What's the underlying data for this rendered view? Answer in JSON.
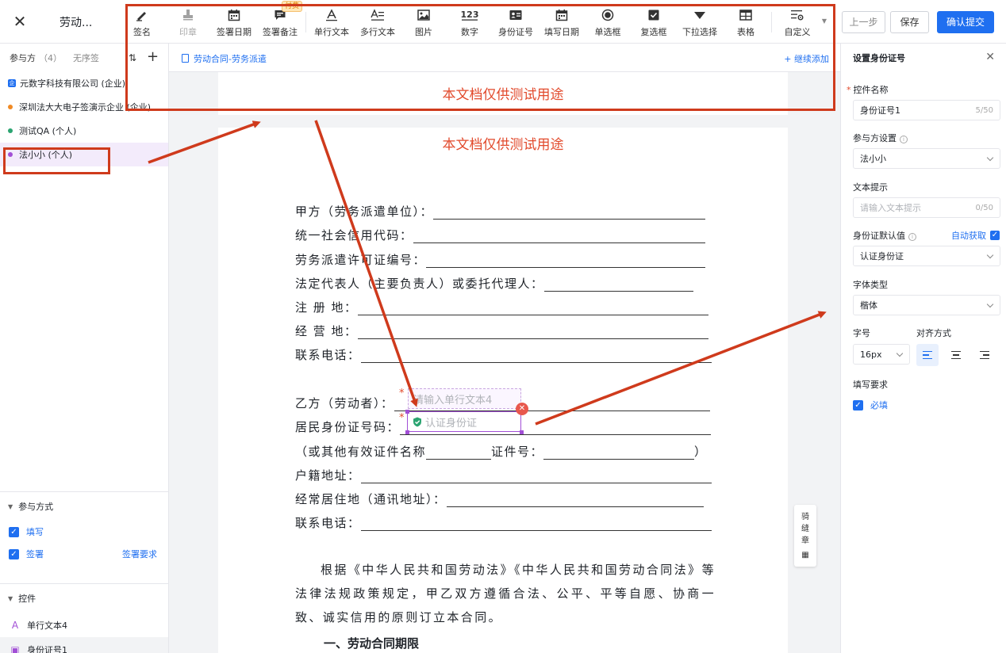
{
  "header": {
    "doc_title": "劳动...",
    "prev_label": "上一步",
    "save_label": "保存",
    "submit_label": "确认提交",
    "paid_tag": "付费"
  },
  "toolbar": [
    {
      "key": "signature",
      "label": "签名",
      "icon": "pen-icon",
      "disabled": false
    },
    {
      "key": "seal",
      "label": "印章",
      "icon": "stamp-icon",
      "disabled": true
    },
    {
      "key": "sign_date",
      "label": "签署日期",
      "icon": "calendar-icon",
      "disabled": false
    },
    {
      "key": "sign_note",
      "label": "签署备注",
      "icon": "comment-icon",
      "disabled": false
    },
    {
      "key": "single_text",
      "label": "单行文本",
      "icon": "text-a-icon",
      "disabled": false
    },
    {
      "key": "multi_text",
      "label": "多行文本",
      "icon": "multiline-text-icon",
      "disabled": false
    },
    {
      "key": "image",
      "label": "图片",
      "icon": "image-icon",
      "disabled": false
    },
    {
      "key": "number",
      "label": "数字",
      "icon": "number-123-icon",
      "disabled": false
    },
    {
      "key": "id_card",
      "label": "身份证号",
      "icon": "id-card-icon",
      "disabled": false
    },
    {
      "key": "fill_date",
      "label": "填写日期",
      "icon": "calendar-icon",
      "disabled": false
    },
    {
      "key": "radio",
      "label": "单选框",
      "icon": "radio-icon",
      "disabled": false
    },
    {
      "key": "checkbox",
      "label": "复选框",
      "icon": "checkbox-icon",
      "disabled": false
    },
    {
      "key": "dropdown",
      "label": "下拉选择",
      "icon": "triangle-down-icon",
      "disabled": false
    },
    {
      "key": "table",
      "label": "表格",
      "icon": "table-icon",
      "disabled": false
    },
    {
      "key": "custom",
      "label": "自定义",
      "icon": "custom-settings-icon",
      "disabled": false
    }
  ],
  "left": {
    "participants_title": "参与方",
    "participants_count": "（4）",
    "no_order": "无序签",
    "parties": [
      {
        "name": "元数字科技有限公司 (企业)",
        "type": "corp",
        "color": "#1f6ff0"
      },
      {
        "name": "深圳法大大电子签演示企业 (企业)",
        "type": "dot",
        "color": "#f08a24"
      },
      {
        "name": "测试QA (个人)",
        "type": "dot",
        "color": "#2ba471"
      },
      {
        "name": "法小小 (个人)",
        "type": "dot",
        "color": "#a24fd6"
      }
    ],
    "method_title": "参与方式",
    "method_fill": "填写",
    "method_sign": "签署",
    "sign_req_link": "签署要求",
    "controls_title": "控件",
    "controls": [
      {
        "label": "单行文本4",
        "icon": "text-a-icon"
      },
      {
        "label": "身份证号1",
        "icon": "id-card-icon"
      }
    ]
  },
  "center": {
    "breadcrumb": "劳动合同-劳务派遣",
    "continue_add": "继续添加",
    "watermark": "本文档仅供测试用途",
    "party_a": [
      "甲方（劳务派遣单位）：",
      "统一社会信用代码：",
      "劳务派遣许可证编号：",
      "法定代表人（主要负责人）或委托代理人：",
      "注  册  地：",
      "经  营  地：",
      "联系电话："
    ],
    "party_b_label": "乙方（劳动者）：",
    "id_label": "居民身份证号码：",
    "other_cert": "（或其他有效证件名称",
    "cert_no": "证件号：",
    "close_paren": "）",
    "party_b_rest": [
      "户籍地址：",
      "经常居住地（通讯地址）：",
      "联系电话："
    ],
    "field_text_placeholder": "请输入单行文本4",
    "field_id_placeholder": "认证身份证",
    "paragraph": "根据《中华人民共和国劳动法》《中华人民共和国劳动合同法》等法律法规政策规定，甲乙双方遵循合法、公平、平等自愿、协商一致、诚实信用的原则订立本合同。",
    "section_heading": "一、劳动合同期限",
    "seam_label": "骑缝章"
  },
  "right": {
    "title": "设置身份证号",
    "name_label": "控件名称",
    "name_value": "身份证号1",
    "name_count": "5/50",
    "party_label": "参与方设置",
    "party_value": "法小小",
    "hint_label": "文本提示",
    "hint_placeholder": "请输入文本提示",
    "hint_count": "0/50",
    "default_label": "身份证默认值",
    "auto_fetch": "自动获取",
    "default_value": "认证身份证",
    "font_type_label": "字体类型",
    "font_type_value": "楷体",
    "font_size_label": "字号",
    "font_size_value": "16px",
    "align_label": "对齐方式",
    "fill_req_label": "填写要求",
    "required_label": "必填"
  },
  "colors": {
    "primary": "#1f6ff0",
    "annotation_red": "#cf3a1c",
    "control_purple": "#a24fd6"
  }
}
